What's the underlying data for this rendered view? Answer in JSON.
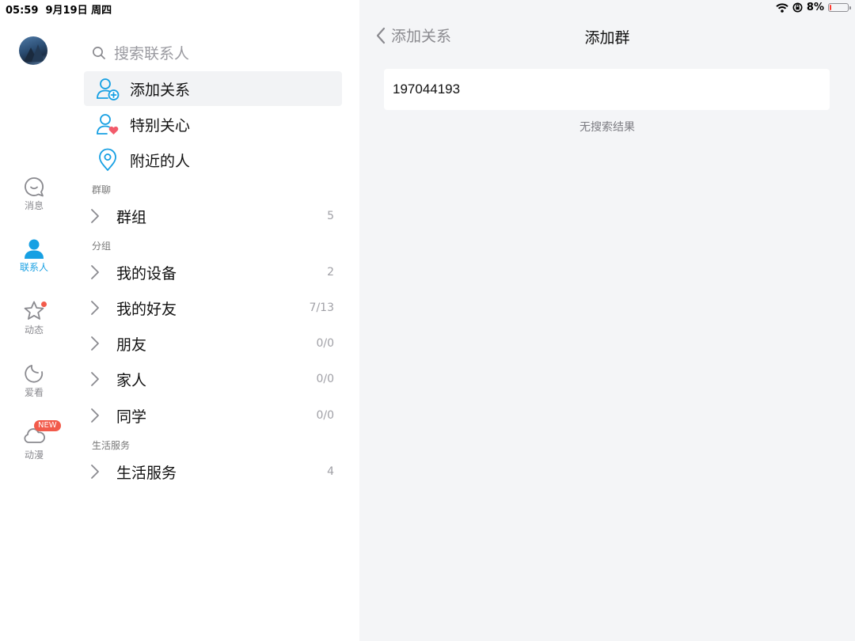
{
  "status_bar": {
    "time": "05:59",
    "date": "9月19日 周四",
    "battery_percent": "8%",
    "icons": [
      "wifi-icon",
      "orientation-lock-icon",
      "battery-icon"
    ]
  },
  "rail": {
    "items": [
      {
        "label": "消息",
        "icon": "message-bubble-icon"
      },
      {
        "label": "联系人",
        "icon": "contact-person-icon",
        "active": true
      },
      {
        "label": "动态",
        "icon": "star-icon",
        "has_dot": true
      },
      {
        "label": "爱看",
        "icon": "moon-swirl-icon"
      },
      {
        "label": "动漫",
        "icon": "cloud-icon",
        "badge": "NEW"
      }
    ]
  },
  "contacts": {
    "search_placeholder": "搜索联系人",
    "menu": [
      {
        "label": "添加关系",
        "icon": "add-contact-icon",
        "selected": true
      },
      {
        "label": "特别关心",
        "icon": "special-care-icon"
      },
      {
        "label": "附近的人",
        "icon": "location-pin-icon"
      }
    ],
    "sections": [
      {
        "header": "群聊",
        "rows": [
          {
            "label": "群组",
            "count": "5"
          }
        ]
      },
      {
        "header": "分组",
        "rows": [
          {
            "label": "我的设备",
            "count": "2"
          },
          {
            "label": "我的好友",
            "count": "7/13"
          },
          {
            "label": "朋友",
            "count": "0/0"
          },
          {
            "label": "家人",
            "count": "0/0"
          },
          {
            "label": "同学",
            "count": "0/0"
          }
        ]
      },
      {
        "header": "生活服务",
        "rows": [
          {
            "label": "生活服务",
            "count": "4"
          }
        ]
      }
    ]
  },
  "detail": {
    "back_label": "添加关系",
    "title": "添加群",
    "search_value": "197044193",
    "no_results": "无搜索结果"
  },
  "colors": {
    "accent": "#17a0e3",
    "badge": "#f25b4b",
    "detail_bg": "#f4f5f7",
    "selected_row": "#f2f3f5"
  }
}
